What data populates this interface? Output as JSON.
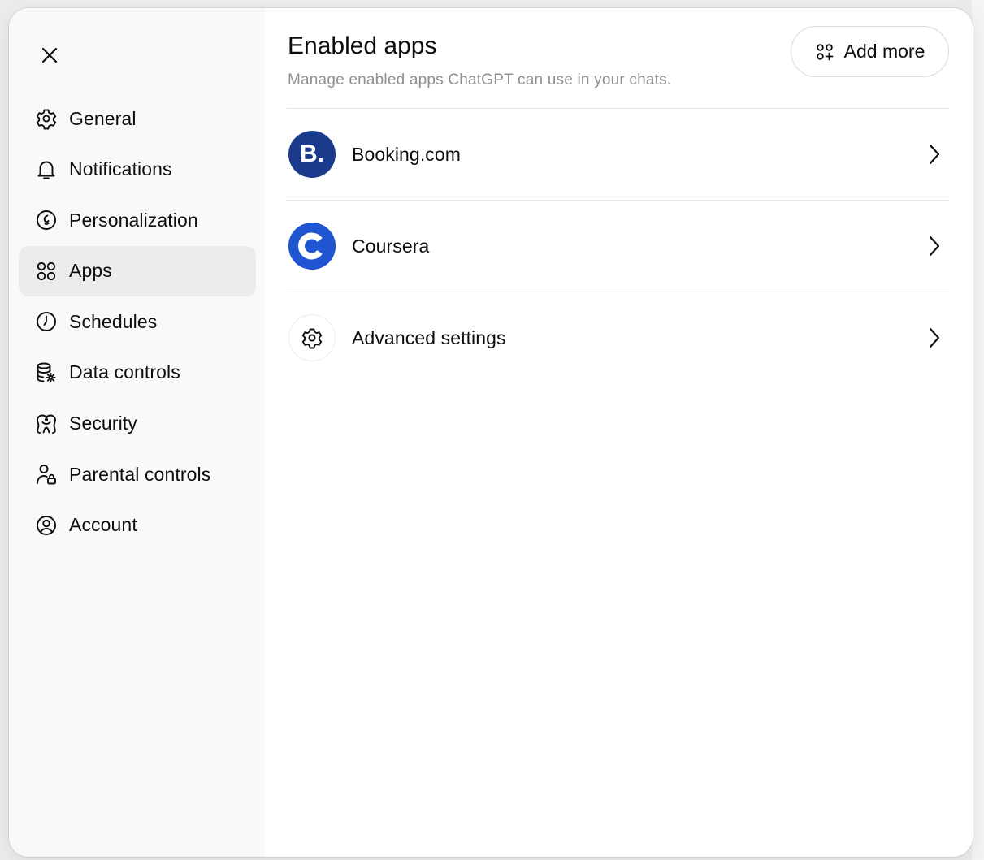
{
  "sidebar": {
    "close_icon": "close-icon",
    "items": [
      {
        "label": "General",
        "icon": "gear-icon",
        "active": false
      },
      {
        "label": "Notifications",
        "icon": "bell-icon",
        "active": false
      },
      {
        "label": "Personalization",
        "icon": "personalization-icon",
        "active": false
      },
      {
        "label": "Apps",
        "icon": "apps-grid-icon",
        "active": true
      },
      {
        "label": "Schedules",
        "icon": "clock-icon",
        "active": false
      },
      {
        "label": "Data controls",
        "icon": "database-settings-icon",
        "active": false
      },
      {
        "label": "Security",
        "icon": "security-icon",
        "active": false
      },
      {
        "label": "Parental controls",
        "icon": "parental-icon",
        "active": false
      },
      {
        "label": "Account",
        "icon": "account-icon",
        "active": false
      }
    ]
  },
  "main": {
    "title": "Enabled apps",
    "subtitle": "Manage enabled apps ChatGPT can use in your chats.",
    "add_button_label": "Add more",
    "apps": [
      {
        "name": "Booking.com",
        "logo_text": "B.",
        "icon": "booking-logo",
        "color": "#1c3a8c"
      },
      {
        "name": "Coursera",
        "icon": "coursera-logo",
        "color": "#1f55d0"
      },
      {
        "name": "Advanced settings",
        "icon": "gear-icon"
      }
    ]
  }
}
